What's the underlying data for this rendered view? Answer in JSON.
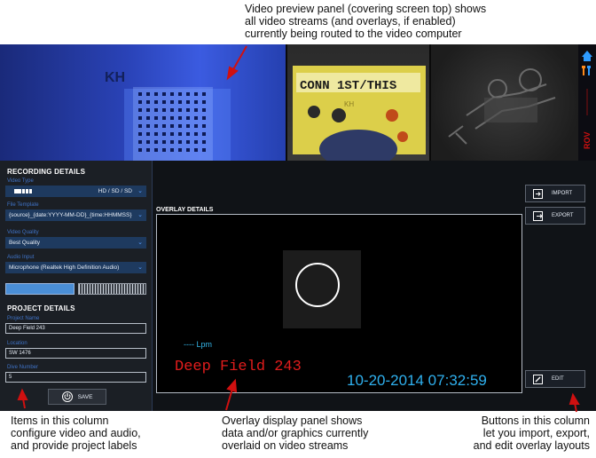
{
  "callouts": {
    "top": [
      "Video preview panel (covering screen top) shows",
      "all video streams (and overlays, if enabled)",
      "currently being routed to the video computer"
    ],
    "left": [
      "Items in this column",
      "configure video and audio,",
      "and provide project labels"
    ],
    "middle": [
      "Overlay display panel shows",
      "data and/or graphics currently",
      "overlaid on video streams"
    ],
    "right": [
      "Buttons in this column",
      "let you import, export,",
      "and edit overlay layouts"
    ]
  },
  "preview": {
    "stream1_text": "KH",
    "stream2_text": "CONN 1ST/THIS",
    "stream2_subtext": "KH",
    "side_vertical_text": "ROV"
  },
  "recording": {
    "title": "RECORDING DETAILS",
    "video_type_label": "Video Type",
    "video_type_value": "HD / SD / SD",
    "file_template_label": "File Template",
    "file_template_value": "{source}_{date:YYYY-MM-DD}_{time:HHMMSS}",
    "video_quality_label": "Video Quality",
    "video_quality_value": "Best Quality",
    "audio_input_label": "Audio Input",
    "audio_input_value": "Microphone (Realtek High Definition Audio)",
    "audio_level": 0.5
  },
  "project": {
    "title": "PROJECT DETAILS",
    "name_label": "Project Name",
    "name_value": "Deep Field 243",
    "location_label": "Location",
    "location_value": "SW 1476",
    "dive_label": "Dive Number",
    "dive_value": "5",
    "save_label": "SAVE"
  },
  "overlay": {
    "title": "OVERLAY DETAILS",
    "lpm_text": "---- Lpm",
    "name_text": "Deep Field 243",
    "datetime_text": "10-20-2014 07:32:59"
  },
  "buttons": {
    "import_label": "IMPORT",
    "export_label": "EXPORT",
    "edit_label": "EDIT"
  },
  "colors": {
    "accent": "#3f73c7",
    "overlay_name": "#e21c1c",
    "overlay_date": "#2fb0ee",
    "arrow": "#d01010"
  }
}
